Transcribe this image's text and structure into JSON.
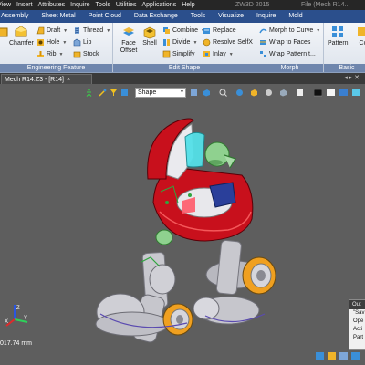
{
  "menubar": {
    "items": [
      "View",
      "Insert",
      "Attributes",
      "Inquire",
      "Tools",
      "Utilities",
      "Applications",
      "Help"
    ],
    "app_title": "ZW3D 2015",
    "file_title": "File (Mech R14..."
  },
  "ribbon_tabs": [
    "Assembly",
    "Sheet Metal",
    "Point Cloud",
    "Data Exchange",
    "Tools",
    "Visualize",
    "Inquire",
    "Mold"
  ],
  "ribbon": {
    "engineering": {
      "label": "Engineering Feature",
      "buttons": {
        "chamfer": "Chamfer",
        "draft": "Draft",
        "hole": "Hole",
        "rib": "Rib",
        "thread": "Thread",
        "lip": "Lip",
        "stock": "Stock"
      }
    },
    "edit_shape": {
      "label": "Edit Shape",
      "buttons": {
        "face_offset_1": "Face",
        "face_offset_2": "Offset",
        "shell": "Shell",
        "combine": "Combine",
        "divide": "Divide",
        "simplify": "Simplify",
        "replace": "Replace",
        "resolve": "Resolve SelfX",
        "inlay": "Inlay"
      }
    },
    "morph": {
      "label": "Morph",
      "buttons": {
        "morph_to_curve": "Morph to Curve",
        "wrap_to_faces": "Wrap to Faces",
        "wrap_pattern": "Wrap Pattern t..."
      }
    },
    "basic": {
      "label": "Basic",
      "buttons": {
        "pattern": "Pattern",
        "co": "Co"
      }
    }
  },
  "document_tab": {
    "label": "Mech R14.Z3 - [R14]",
    "close": "×"
  },
  "viewport": {
    "shape_filter": "Shape",
    "scale_readout": "017.74 mm"
  },
  "output": {
    "title": "Out",
    "lines": [
      "\"Sav",
      "Ope",
      "Acti",
      "Part"
    ]
  },
  "colors": {
    "menubar": "#262626",
    "ribbon_tabs": "#2b4f8c",
    "viewport_bg": "#5e5e5e",
    "body_red": "#c8101c",
    "wheel_orange": "#f0a020"
  },
  "icons": [
    "chamfer-icon",
    "draft-icon",
    "hole-icon",
    "rib-icon",
    "thread-icon",
    "lip-icon",
    "stock-icon",
    "face-offset-icon",
    "shell-icon",
    "combine-icon",
    "divide-icon",
    "simplify-icon",
    "replace-icon",
    "resolve-icon",
    "inlay-icon",
    "morph-icon",
    "wrap-icon",
    "pattern-icon",
    "triad-icon"
  ]
}
